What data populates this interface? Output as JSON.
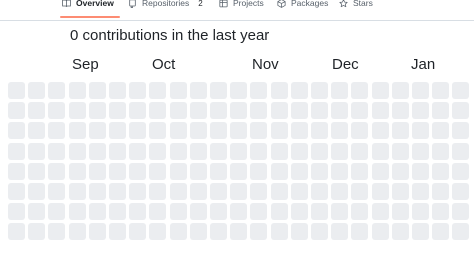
{
  "tabs": [
    {
      "label": "Overview",
      "icon": "book-icon",
      "active": true
    },
    {
      "label": "Repositories",
      "icon": "repo-icon",
      "count": "2"
    },
    {
      "label": "Projects",
      "icon": "table-icon"
    },
    {
      "label": "Packages",
      "icon": "package-icon"
    },
    {
      "label": "Stars",
      "icon": "star-icon"
    }
  ],
  "heading": "0 contributions in the last year",
  "months": [
    "Sep",
    "Oct",
    "Nov",
    "Dec",
    "Jan"
  ],
  "grid": {
    "rows": 8,
    "cols": 23,
    "empty_color": "#ebedf0",
    "contributions": 0
  },
  "colors": {
    "accent_underline": "#fd8c73",
    "border": "#d8dee4"
  }
}
